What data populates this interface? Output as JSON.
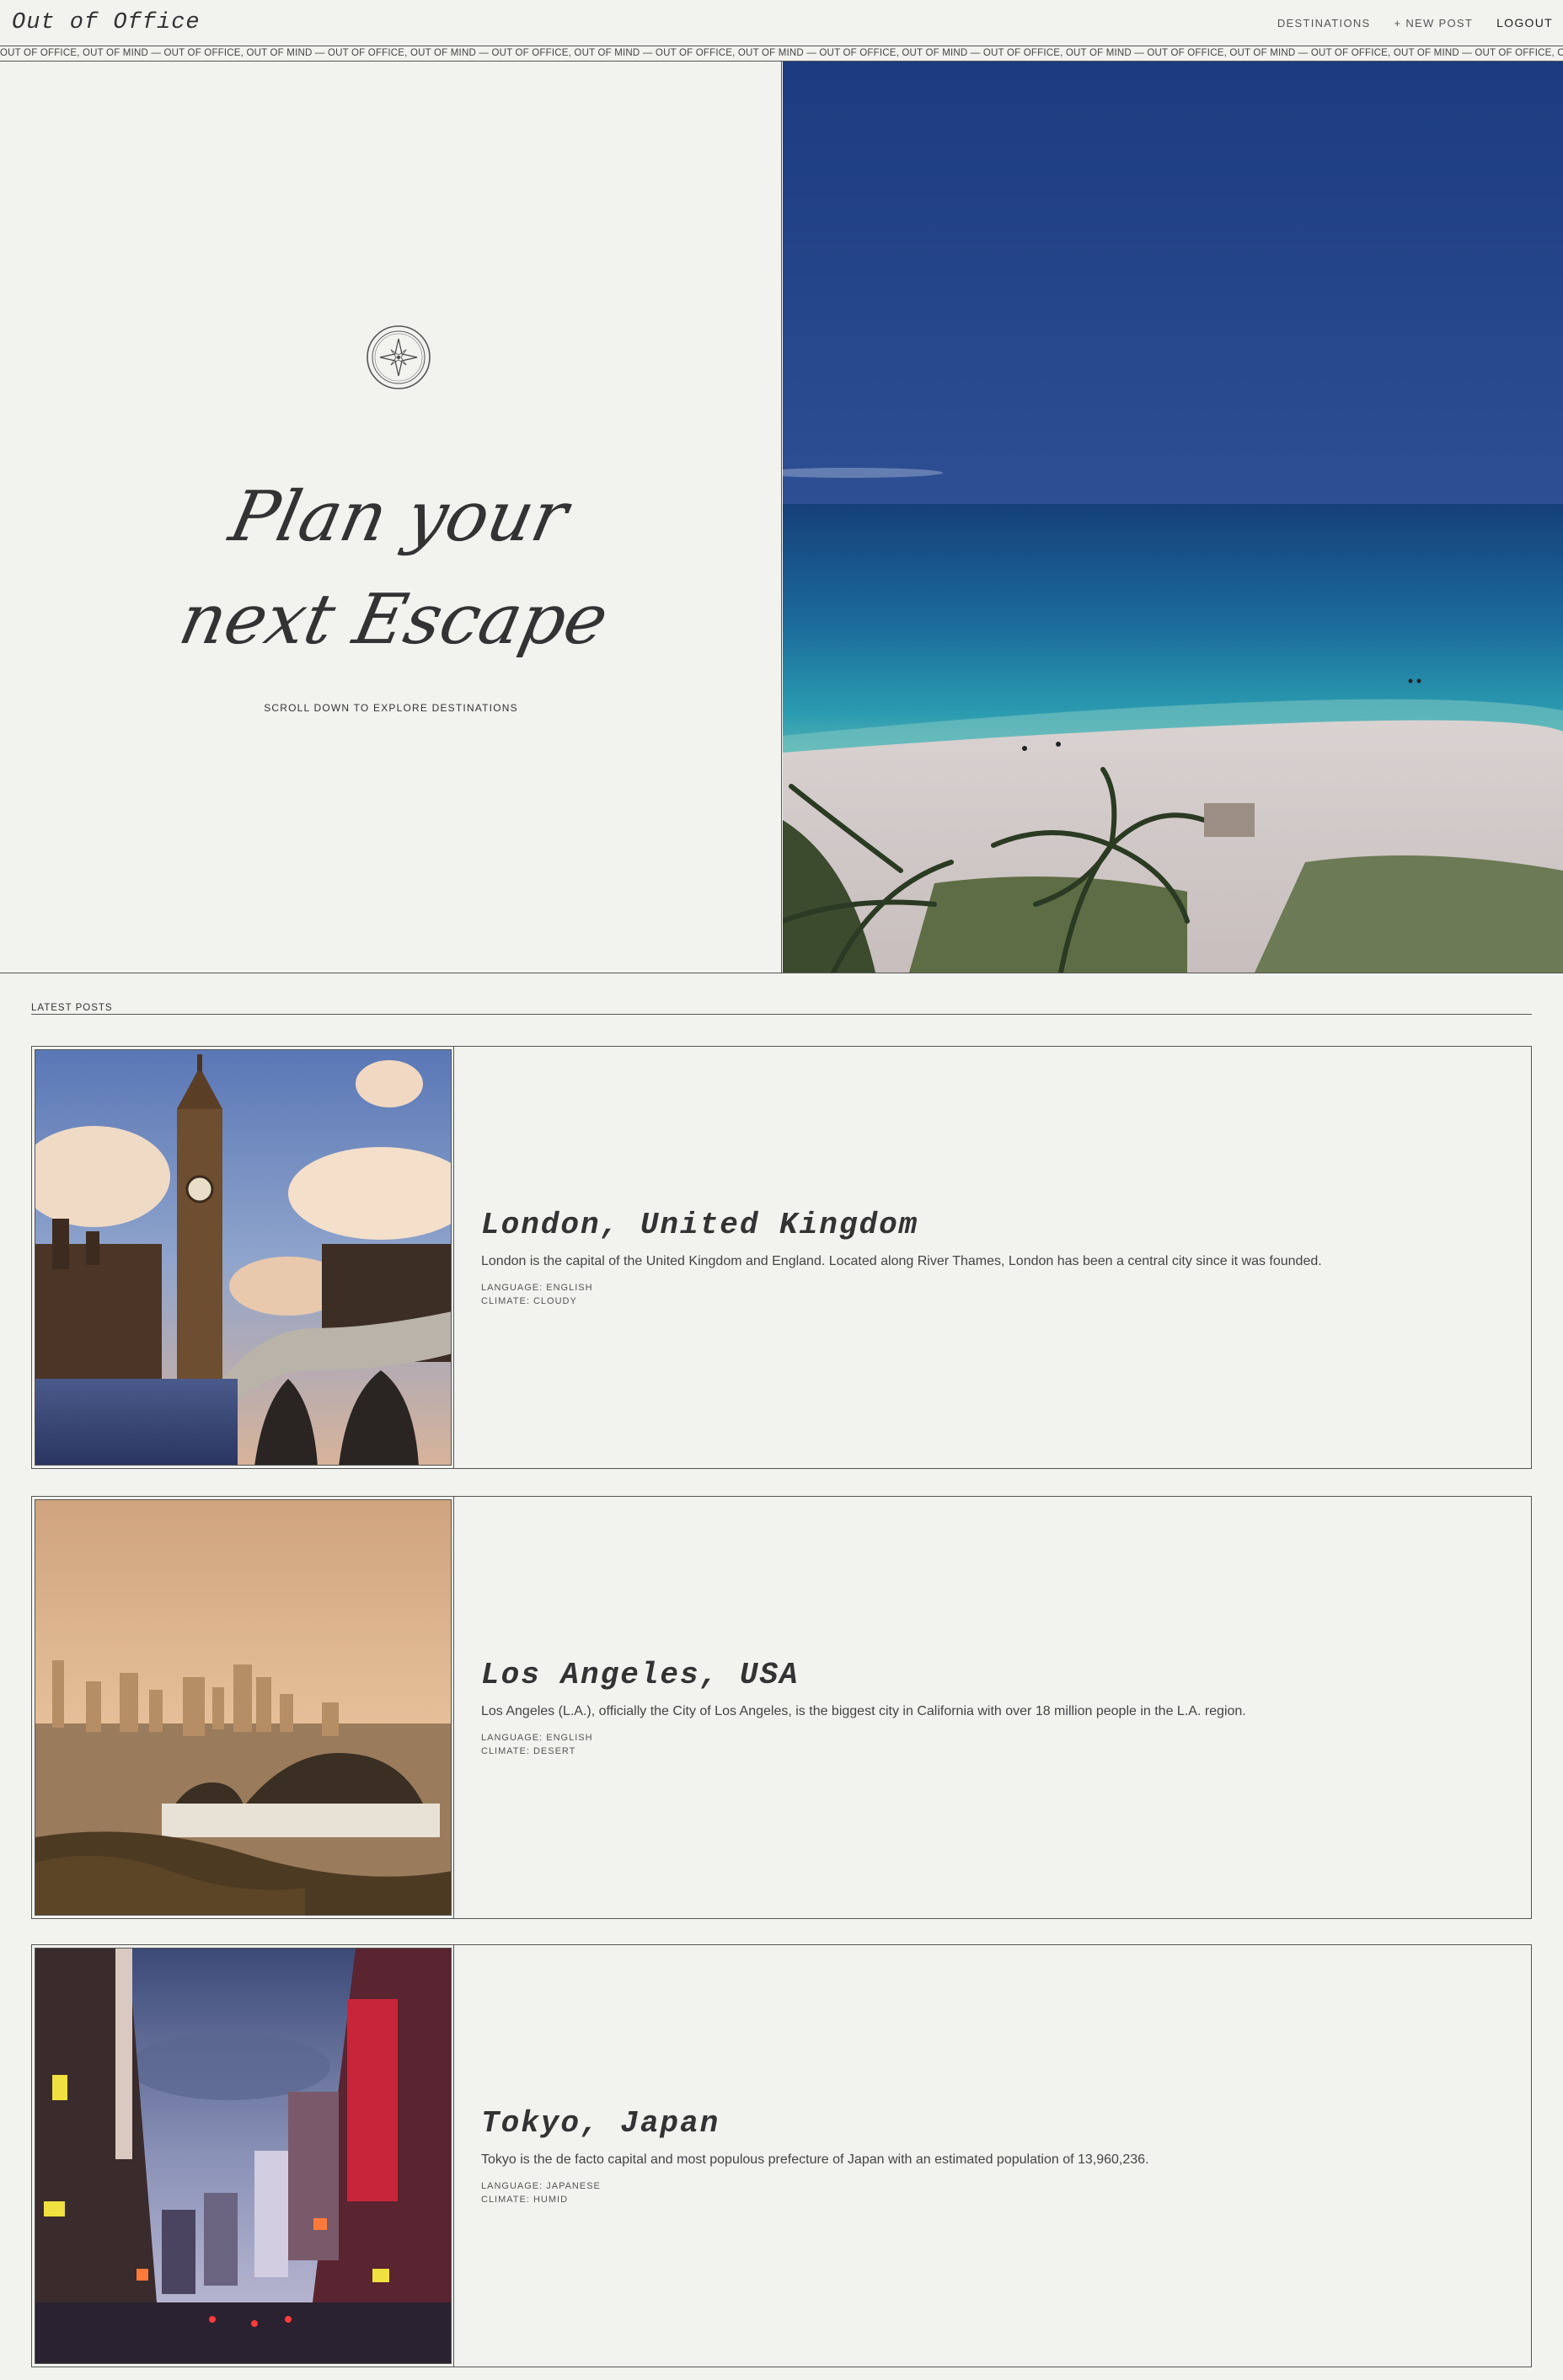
{
  "nav": {
    "brand": "Out of Office",
    "links": [
      "DESTINATIONS",
      "+ NEW POST"
    ],
    "logout": "LOGOUT"
  },
  "marquee": {
    "text": "OUT OF OFFICE, OUT OF MIND — OUT OF OFFICE, OUT OF MIND — OUT OF OFFICE, OUT OF MIND — OUT OF OFFICE, OUT OF MIND — OUT OF OFFICE, OUT OF MIND — OUT OF OFFICE, OUT OF MIND — OUT OF OFFICE, OUT OF MIND — OUT OF OFFICE, OUT OF MIND — OUT OF OFFICE, OUT OF MIND — OUT OF OFFICE, OUT OF MIND — OUT OF OFFICE,"
  },
  "hero": {
    "title_line1": "Plan your",
    "title_line2": "next Escape",
    "scroll_hint": "SCROLL DOWN TO EXPLORE DESTINATIONS"
  },
  "latest": {
    "label": "LATEST POSTS"
  },
  "posts": [
    {
      "title": "London, United Kingdom",
      "description": "London is the capital of the United Kingdom and England. Located along River Thames, London has been a central city since it was founded.",
      "language": "LANGUAGE: ENGLISH",
      "climate": "CLIMATE: CLOUDY"
    },
    {
      "title": "Los Angeles, USA",
      "description": "Los Angeles (L.A.), officially the City of Los Angeles, is the biggest city in California with over 18 million people in the L.A. region.",
      "language": "LANGUAGE: ENGLISH",
      "climate": "CLIMATE: DESERT"
    },
    {
      "title": "Tokyo, Japan",
      "description": "Tokyo is the de facto capital and most populous prefecture of Japan with an estimated population of 13,960,236.",
      "language": "LANGUAGE: JAPANESE",
      "climate": "CLIMATE: HUMID"
    }
  ]
}
